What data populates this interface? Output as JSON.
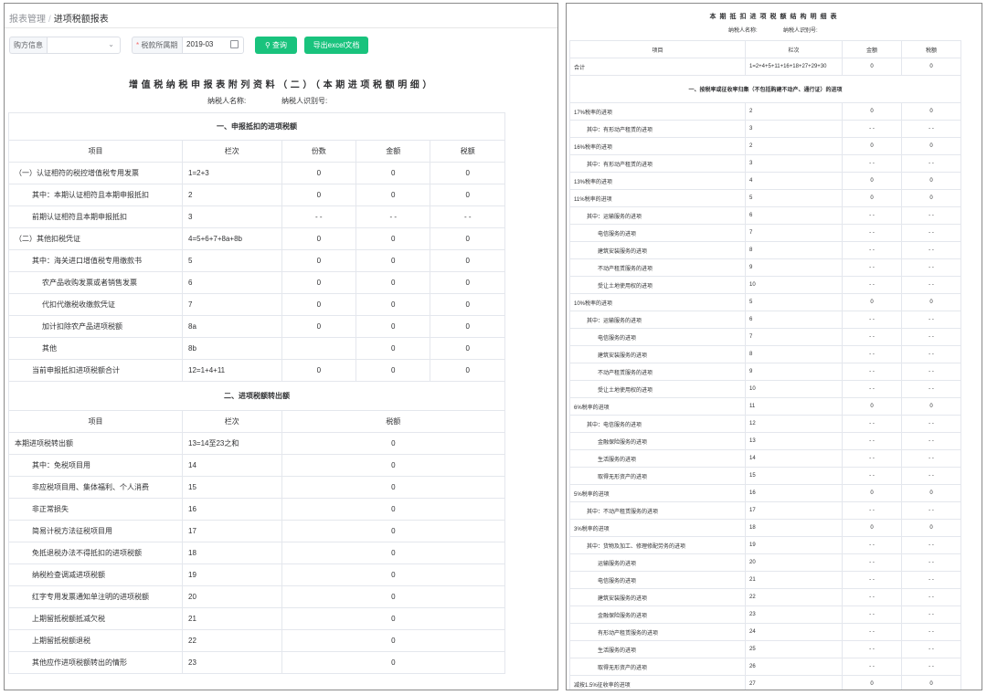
{
  "breadcrumb": {
    "parent": "报表管理",
    "separator": "/",
    "current": "进项税额报表"
  },
  "filters": {
    "buyer_label": "购方信息",
    "buyer_value": "",
    "period_label": "税款所属期",
    "period_required_mark": "*",
    "period_value": "2019-03",
    "query_button": "查询",
    "export_button": "导出excel文档"
  },
  "left": {
    "title": "增值税纳税申报表附列资料（二）（本期进项税额明细）",
    "taxpayer_name_label": "纳税人名称:",
    "taxpayer_id_label": "纳税人识别号:",
    "section1": {
      "title": "一、申报抵扣的进项税额",
      "headers": [
        "项目",
        "栏次",
        "份数",
        "金额",
        "税额"
      ],
      "rows": [
        {
          "item": "（一）认证相符的税控增值税专用发票",
          "col": "1=2+3",
          "count": "0",
          "amount": "0",
          "tax": "0",
          "indent": 0
        },
        {
          "item": "其中：本期认证相符且本期申报抵扣",
          "col": "2",
          "count": "0",
          "amount": "0",
          "tax": "0",
          "indent": 1
        },
        {
          "item": "前期认证相符且本期申报抵扣",
          "col": "3",
          "count": "- -",
          "amount": "- -",
          "tax": "- -",
          "indent": 1
        },
        {
          "item": "（二）其他扣税凭证",
          "col": "4=5+6+7+8a+8b",
          "count": "0",
          "amount": "0",
          "tax": "0",
          "indent": 0
        },
        {
          "item": "其中：海关进口增值税专用缴款书",
          "col": "5",
          "count": "0",
          "amount": "0",
          "tax": "0",
          "indent": 1
        },
        {
          "item": "农产品收购发票或者销售发票",
          "col": "6",
          "count": "0",
          "amount": "0",
          "tax": "0",
          "indent": 2
        },
        {
          "item": "代扣代缴税收缴款凭证",
          "col": "7",
          "count": "0",
          "amount": "0",
          "tax": "0",
          "indent": 2
        },
        {
          "item": "加计扣除农产品进项税额",
          "col": "8a",
          "count": "0",
          "amount": "0",
          "tax": "0",
          "indent": 2
        },
        {
          "item": "其他",
          "col": "8b",
          "count": "",
          "amount": "0",
          "tax": "0",
          "indent": 2
        },
        {
          "item": "当前申报抵扣进项税额合计",
          "col": "12=1+4+11",
          "count": "0",
          "amount": "0",
          "tax": "0",
          "indent": 1
        }
      ]
    },
    "section2": {
      "title": "二、进项税额转出额",
      "headers": [
        "项目",
        "栏次",
        "税额"
      ],
      "rows": [
        {
          "item": "本期进项税转出额",
          "col": "13=14至23之和",
          "tax": "0",
          "indent": 0
        },
        {
          "item": "其中：免税项目用",
          "col": "14",
          "tax": "0",
          "indent": 1
        },
        {
          "item": "非应税项目用、集体福利、个人消费",
          "col": "15",
          "tax": "0",
          "indent": 1
        },
        {
          "item": "非正常损失",
          "col": "16",
          "tax": "0",
          "indent": 1
        },
        {
          "item": "简易计税方法征税项目用",
          "col": "17",
          "tax": "0",
          "indent": 1
        },
        {
          "item": "免抵退税办法不得抵扣的进项税额",
          "col": "18",
          "tax": "0",
          "indent": 1
        },
        {
          "item": "纳税检查调减进项税额",
          "col": "19",
          "tax": "0",
          "indent": 1
        },
        {
          "item": "红字专用发票通知单注明的进项税额",
          "col": "20",
          "tax": "0",
          "indent": 1
        },
        {
          "item": "上期留抵税额抵减欠税",
          "col": "21",
          "tax": "0",
          "indent": 1
        },
        {
          "item": "上期留抵税额退税",
          "col": "22",
          "tax": "0",
          "indent": 1
        },
        {
          "item": "其他应作进项税额转出的情形",
          "col": "23",
          "tax": "0",
          "indent": 1
        }
      ]
    }
  },
  "right": {
    "title": "本期抵扣进项税额结构明细表",
    "taxpayer_name_label": "纳税人名称:",
    "taxpayer_id_label": "纳税人识别号:",
    "headers": [
      "项目",
      "栏次",
      "金额",
      "税额"
    ],
    "total": {
      "item": "合计",
      "col": "1=2+4+5+11+16+18+27+29+30",
      "amount": "0",
      "tax": "0"
    },
    "section_title": "一、按税率或征收率归集（不包括购建不动产、通行证）的进项",
    "rows": [
      {
        "item": "17%税率的进项",
        "col": "2",
        "amount": "0",
        "tax": "0",
        "indent": 0
      },
      {
        "item": "其中：有形动产租赁的进项",
        "col": "3",
        "amount": "- -",
        "tax": "- -",
        "indent": 1
      },
      {
        "item": "16%税率的进项",
        "col": "2",
        "amount": "0",
        "tax": "0",
        "indent": 0
      },
      {
        "item": "其中：有形动产租赁的进项",
        "col": "3",
        "amount": "- -",
        "tax": "- -",
        "indent": 1
      },
      {
        "item": "13%税率的进项",
        "col": "4",
        "amount": "0",
        "tax": "0",
        "indent": 0
      },
      {
        "item": "11%税率的进项",
        "col": "5",
        "amount": "0",
        "tax": "0",
        "indent": 0
      },
      {
        "item": "其中：运输服务的进项",
        "col": "6",
        "amount": "- -",
        "tax": "- -",
        "indent": 1
      },
      {
        "item": "电信服务的进项",
        "col": "7",
        "amount": "- -",
        "tax": "- -",
        "indent": 2
      },
      {
        "item": "建筑安装服务的进项",
        "col": "8",
        "amount": "- -",
        "tax": "- -",
        "indent": 2
      },
      {
        "item": "不动产租赁服务的进项",
        "col": "9",
        "amount": "- -",
        "tax": "- -",
        "indent": 2
      },
      {
        "item": "受让土地使用权的进项",
        "col": "10",
        "amount": "- -",
        "tax": "- -",
        "indent": 2
      },
      {
        "item": "10%税率的进项",
        "col": "5",
        "amount": "0",
        "tax": "0",
        "indent": 0
      },
      {
        "item": "其中：运输服务的进项",
        "col": "6",
        "amount": "- -",
        "tax": "- -",
        "indent": 1
      },
      {
        "item": "电信服务的进项",
        "col": "7",
        "amount": "- -",
        "tax": "- -",
        "indent": 2
      },
      {
        "item": "建筑安装服务的进项",
        "col": "8",
        "amount": "- -",
        "tax": "- -",
        "indent": 2
      },
      {
        "item": "不动产租赁服务的进项",
        "col": "9",
        "amount": "- -",
        "tax": "- -",
        "indent": 2
      },
      {
        "item": "受让土地使用权的进项",
        "col": "10",
        "amount": "- -",
        "tax": "- -",
        "indent": 2
      },
      {
        "item": "6%税率的进项",
        "col": "11",
        "amount": "0",
        "tax": "0",
        "indent": 0
      },
      {
        "item": "其中：电信服务的进项",
        "col": "12",
        "amount": "- -",
        "tax": "- -",
        "indent": 1
      },
      {
        "item": "金融保险服务的进项",
        "col": "13",
        "amount": "- -",
        "tax": "- -",
        "indent": 2
      },
      {
        "item": "生活服务的进项",
        "col": "14",
        "amount": "- -",
        "tax": "- -",
        "indent": 2
      },
      {
        "item": "取得无形资产的进项",
        "col": "15",
        "amount": "- -",
        "tax": "- -",
        "indent": 2
      },
      {
        "item": "5%税率的进项",
        "col": "16",
        "amount": "0",
        "tax": "0",
        "indent": 0
      },
      {
        "item": "其中：不动产租赁服务的进项",
        "col": "17",
        "amount": "- -",
        "tax": "- -",
        "indent": 1
      },
      {
        "item": "3%税率的进项",
        "col": "18",
        "amount": "0",
        "tax": "0",
        "indent": 0
      },
      {
        "item": "其中：货物及加工、修理修配劳务的进项",
        "col": "19",
        "amount": "- -",
        "tax": "- -",
        "indent": 1
      },
      {
        "item": "运输服务的进项",
        "col": "20",
        "amount": "- -",
        "tax": "- -",
        "indent": 2
      },
      {
        "item": "电信服务的进项",
        "col": "21",
        "amount": "- -",
        "tax": "- -",
        "indent": 2
      },
      {
        "item": "建筑安装服务的进项",
        "col": "22",
        "amount": "- -",
        "tax": "- -",
        "indent": 2
      },
      {
        "item": "金融保险服务的进项",
        "col": "23",
        "amount": "- -",
        "tax": "- -",
        "indent": 2
      },
      {
        "item": "有形动产租赁服务的进项",
        "col": "24",
        "amount": "- -",
        "tax": "- -",
        "indent": 2
      },
      {
        "item": "生活服务的进项",
        "col": "25",
        "amount": "- -",
        "tax": "- -",
        "indent": 2
      },
      {
        "item": "取得无形资产的进项",
        "col": "26",
        "amount": "- -",
        "tax": "- -",
        "indent": 2
      },
      {
        "item": "减按1.5%征收率的进项",
        "col": "27",
        "amount": "0",
        "tax": "0",
        "indent": 0
      }
    ]
  },
  "colors": {
    "accent": "#19c37d",
    "border": "#e4e7ed",
    "required": "#f56c6c"
  },
  "icons": {
    "search": "search-icon",
    "dropdown": "chevron-down-icon",
    "calendar": "calendar-icon"
  }
}
